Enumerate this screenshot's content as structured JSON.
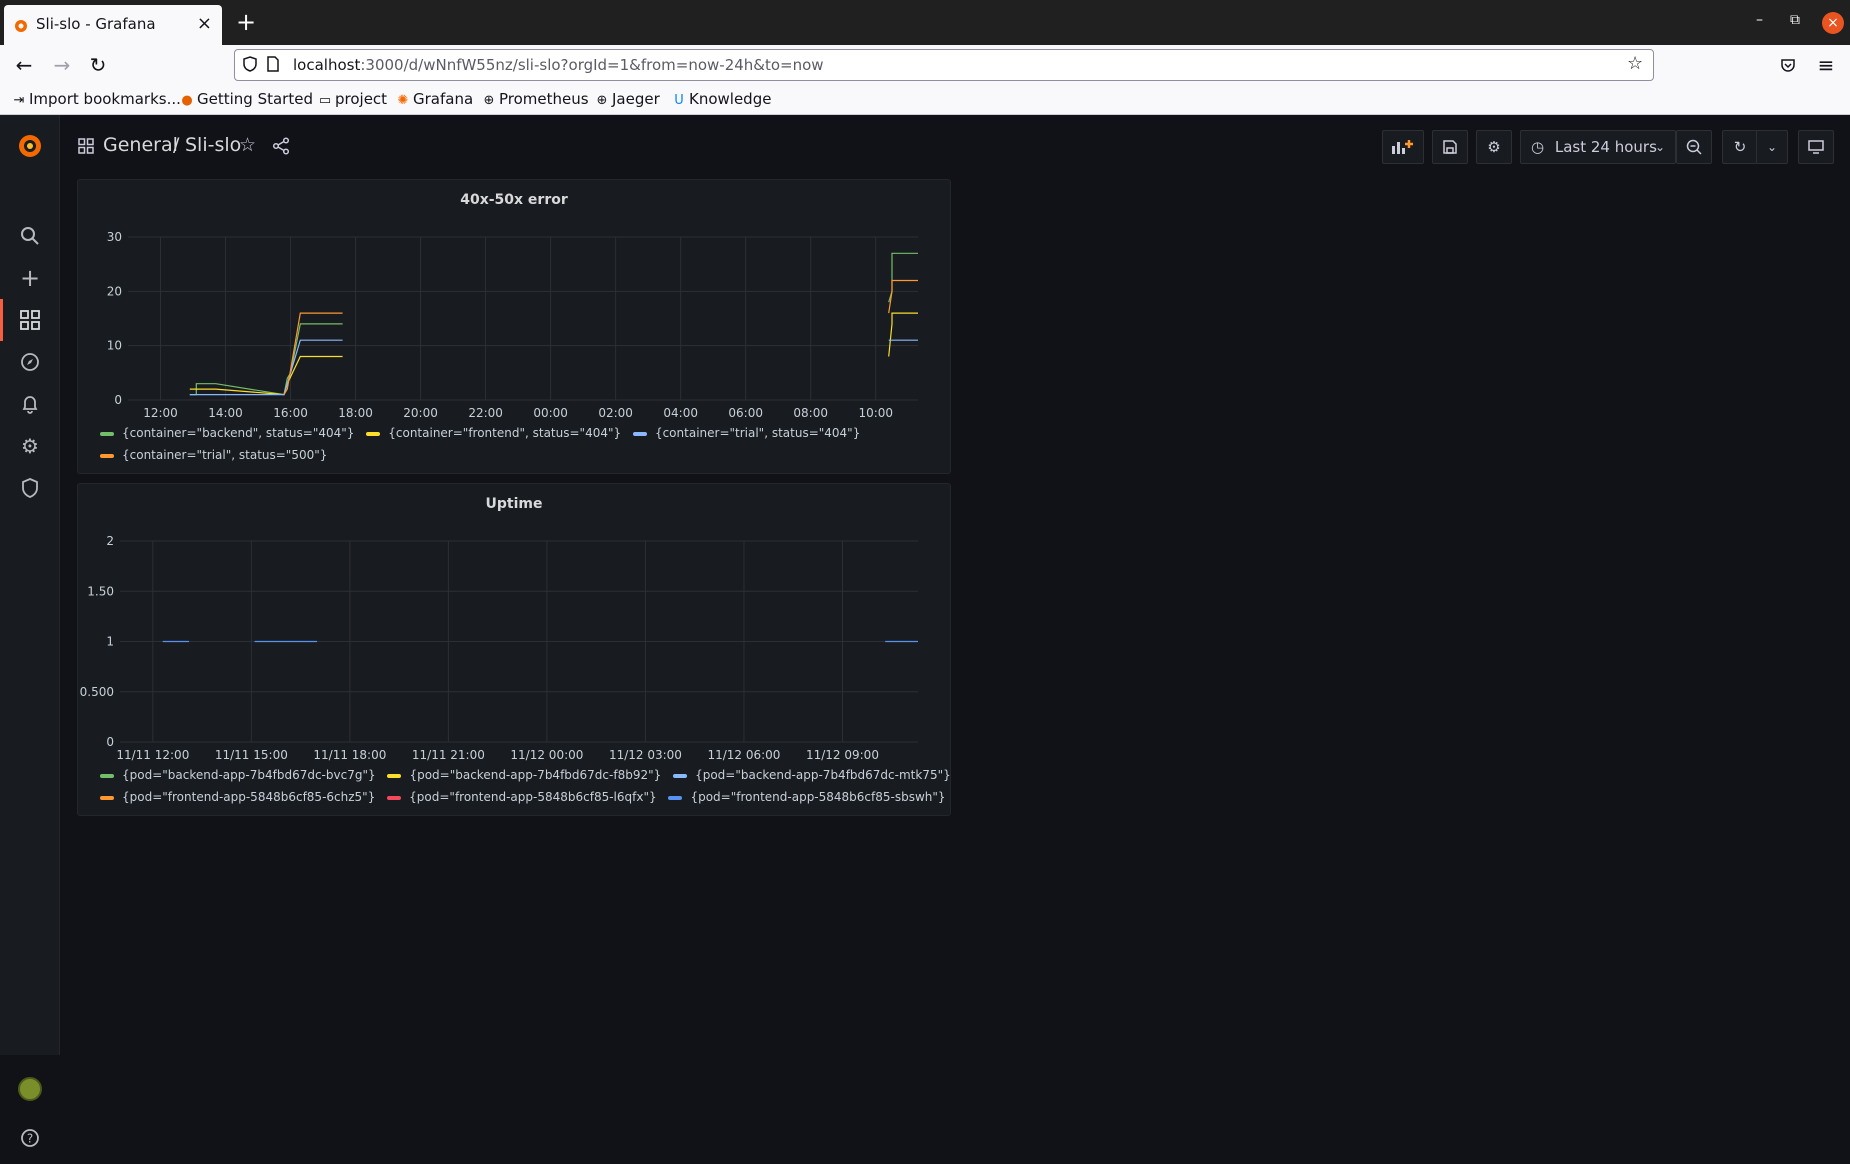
{
  "browser": {
    "tab_title": "Sli-slo - Grafana",
    "url_host": "localhost",
    "url_rest": ":3000/d/wNnfW55nz/sli-slo?orgId=1&from=now-24h&to=now",
    "bookmarks": [
      "Import bookmarks...",
      "Getting Started",
      "project",
      "Grafana",
      "Prometheus",
      "Jaeger",
      "Knowledge"
    ]
  },
  "dashboard": {
    "breadcrumb_folder": "General",
    "breadcrumb_separator": "/",
    "title": "Sli-slo",
    "time_range": "Last 24 hours"
  },
  "panels": [
    {
      "title": "40x-50x error",
      "legend": [
        {
          "name": "{container=\"backend\", status=\"404\"}",
          "color": "#73bf69"
        },
        {
          "name": "{container=\"frontend\", status=\"404\"}",
          "color": "#fade2a"
        },
        {
          "name": "{container=\"trial\", status=\"404\"}",
          "color": "#8ab8ff"
        },
        {
          "name": "{container=\"trial\", status=\"500\"}",
          "color": "#ff9830"
        }
      ]
    },
    {
      "title": "Uptime",
      "legend": [
        {
          "name": "{pod=\"backend-app-7b4fbd67dc-bvc7g\"}",
          "color": "#73bf69"
        },
        {
          "name": "{pod=\"backend-app-7b4fbd67dc-f8b92\"}",
          "color": "#fade2a"
        },
        {
          "name": "{pod=\"backend-app-7b4fbd67dc-mtk75\"}",
          "color": "#8ab8ff"
        },
        {
          "name": "{pod=\"frontend-app-5848b6cf85-6chz5\"}",
          "color": "#ff9830"
        },
        {
          "name": "{pod=\"frontend-app-5848b6cf85-l6qfx\"}",
          "color": "#f2495c"
        },
        {
          "name": "{pod=\"frontend-app-5848b6cf85-sbswh\"}",
          "color": "#5794f2"
        }
      ]
    }
  ],
  "chart_data": [
    {
      "type": "line",
      "title": "40x-50x error",
      "x_ticks": [
        "12:00",
        "14:00",
        "16:00",
        "18:00",
        "20:00",
        "22:00",
        "00:00",
        "02:00",
        "04:00",
        "06:00",
        "08:00",
        "10:00"
      ],
      "y_ticks": [
        "0",
        "10",
        "20",
        "30"
      ],
      "ylim": [
        0,
        30
      ],
      "xlim_hours": [
        11.0,
        35.3
      ],
      "grid": true,
      "legend_position": "bottom-left",
      "series": [
        {
          "name": "{container=\"backend\", status=\"404\"}",
          "color": "#73bf69",
          "x": [
            12.9,
            13.1,
            13.1,
            13.7,
            15.8,
            15.9,
            15.9,
            16.0,
            16.0,
            16.3,
            16.3,
            17.6,
            NaN,
            34.4,
            34.5,
            34.5,
            35.3
          ],
          "y": [
            1,
            1,
            3,
            3,
            1,
            4,
            4,
            5,
            5,
            14,
            14,
            14,
            null,
            18,
            20,
            27,
            27
          ]
        },
        {
          "name": "{container=\"frontend\", status=\"404\"}",
          "color": "#fade2a",
          "x": [
            12.9,
            13.1,
            13.1,
            13.7,
            15.8,
            15.9,
            15.9,
            16.3,
            16.3,
            17.6,
            null,
            34.4,
            34.5,
            34.5,
            35.3
          ],
          "y": [
            2,
            2,
            2,
            2,
            1,
            3,
            3,
            8,
            8,
            8,
            null,
            8,
            14,
            16,
            16
          ]
        },
        {
          "name": "{container=\"trial\", status=\"404\"}",
          "color": "#8ab8ff",
          "x": [
            12.9,
            13.1,
            13.1,
            13.7,
            15.8,
            15.9,
            15.9,
            16.3,
            16.3,
            17.6,
            null,
            34.4,
            34.5,
            34.5,
            35.3
          ],
          "y": [
            1,
            1,
            1,
            1,
            1,
            3,
            3,
            11,
            11,
            11,
            null,
            11,
            11,
            11,
            11
          ]
        },
        {
          "name": "{container=\"trial\", status=\"500\"}",
          "color": "#ff9830",
          "x": [
            15.8,
            15.9,
            15.9,
            16.3,
            16.3,
            17.6,
            null,
            34.4,
            34.5,
            34.5,
            35.3
          ],
          "y": [
            1,
            2,
            2,
            16,
            16,
            16,
            null,
            16,
            20,
            22,
            22
          ]
        }
      ]
    },
    {
      "type": "line",
      "title": "Uptime",
      "x_ticks": [
        "11/11 12:00",
        "11/11 15:00",
        "11/11 18:00",
        "11/11 21:00",
        "11/12 00:00",
        "11/12 03:00",
        "11/12 06:00",
        "11/12 09:00"
      ],
      "y_ticks": [
        "0",
        "0.500",
        "1",
        "1.50",
        "2"
      ],
      "ylim": [
        0,
        2
      ],
      "xlim_hours": [
        11.0,
        35.3
      ],
      "grid": true,
      "legend_position": "bottom-left",
      "series": [
        {
          "name": "{pod=\"frontend-app-5848b6cf85-sbswh\"}",
          "color": "#5794f2",
          "x": [
            12.3,
            13.1,
            null,
            15.1,
            17.0,
            null,
            34.3,
            35.3
          ],
          "y": [
            1,
            1,
            null,
            1,
            1,
            null,
            1,
            1
          ]
        }
      ]
    }
  ]
}
